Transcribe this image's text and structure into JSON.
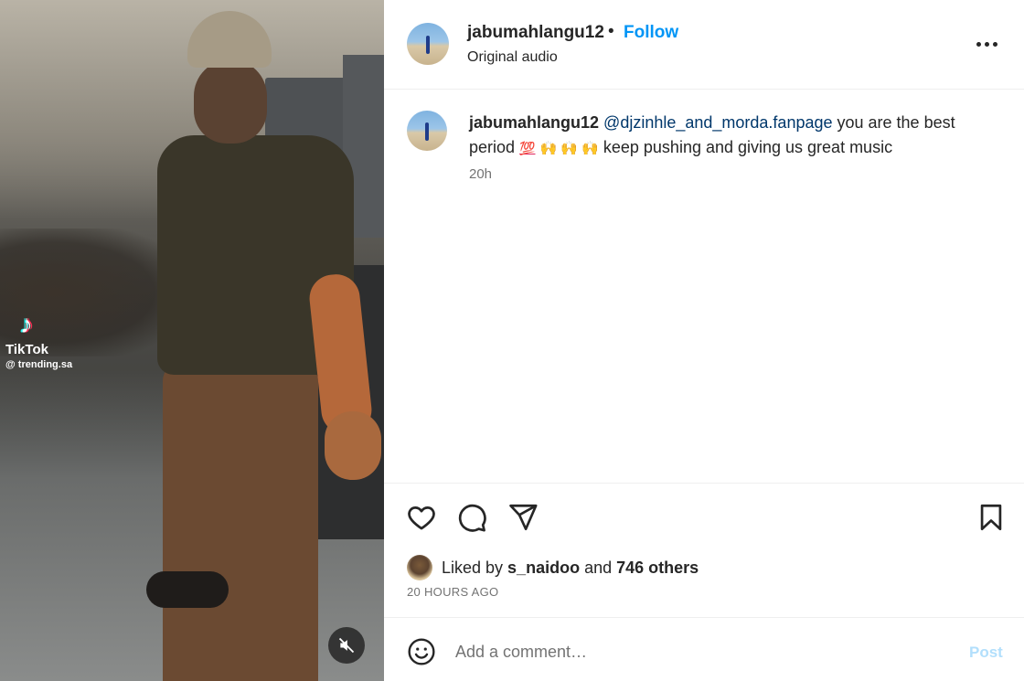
{
  "media": {
    "watermark_brand": "TikTok",
    "watermark_handle": "@ trending.sa",
    "mute_icon": "speaker-muted-icon"
  },
  "header": {
    "username": "jabumahlangu12",
    "separator": "•",
    "follow_label": "Follow",
    "audio_label": "Original audio",
    "more_icon": "more-options-icon"
  },
  "comment": {
    "username": "jabumahlangu12",
    "mention": "@djzinhle_and_morda.fanpage",
    "text_1": " you are the best period ",
    "emoji_100": "💯",
    "emoji_raised_hands": "🙌 🙌 🙌",
    "text_2": " keep pushing and giving us great music",
    "time": "20h"
  },
  "actions": {
    "like_icon": "heart-icon",
    "comment_icon": "comment-bubble-icon",
    "share_icon": "paper-plane-icon",
    "save_icon": "bookmark-icon"
  },
  "likes": {
    "prefix": "Liked by ",
    "liker": "s_naidoo",
    "middle": " and ",
    "others": "746 others"
  },
  "post_time": "20 HOURS AGO",
  "add_comment": {
    "placeholder": "Add a comment…",
    "post_label": "Post",
    "emoji_icon": "smiley-icon"
  },
  "colors": {
    "accent": "#0095f6",
    "post_disabled": "#b2dffc",
    "mention": "#00376b",
    "secondary_text": "#737373"
  }
}
